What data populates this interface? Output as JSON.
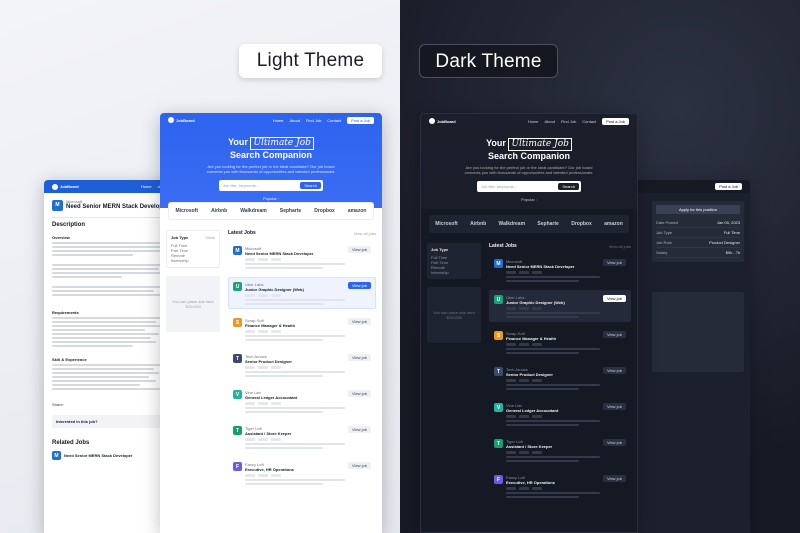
{
  "labels": {
    "light": "Light Theme",
    "dark": "Dark Theme"
  },
  "brand": {
    "name": "JobBoard"
  },
  "nav": [
    "Home",
    "About",
    "Find Job",
    "Contact"
  ],
  "signup": "Post a Job",
  "hero": {
    "line1_prefix": "Your",
    "highlight": "Ultimate Job",
    "line2": "Search Companion",
    "sub": "Are you looking for the perfect job or the ideal candidate? Our job board connects you with thousands of opportunities and talented professionals.",
    "search_placeholder": "Job title, keywords...",
    "search_button": "Search",
    "popular_label": "Popular :"
  },
  "brands": [
    "Microsoft",
    "Airbnb",
    "Walkdream",
    "Sepharte",
    "Dropbox",
    "amazon"
  ],
  "filters": {
    "title": "Job Type",
    "reset": "Clear",
    "items": [
      "Full Time",
      "Part Time",
      "Remote",
      "Internship"
    ],
    "ad": "You can place ads here 300×250"
  },
  "latest": {
    "title": "Latest Jobs",
    "view_all": "View all jobs"
  },
  "jobs": [
    {
      "company": "Microsoft",
      "title": "Need Senior MERN Stack Developer",
      "tags": [
        "Full Time",
        "Mid Level",
        "Remote"
      ],
      "apply": "View job",
      "color": "#1f6fd1",
      "letter": "M"
    },
    {
      "company": "Uber Labs",
      "title": "Junior Graphic Designer (Web)",
      "tags": [
        "Part Time",
        "Entry",
        "Onsite"
      ],
      "apply": "View job",
      "color": "#1aa37a",
      "letter": "U"
    },
    {
      "company": "Scrap Soft",
      "title": "Finance Manager & Health",
      "tags": [
        "Full Time",
        "Senior",
        "Remote"
      ],
      "apply": "View job",
      "color": "#e69b1b",
      "letter": "S"
    },
    {
      "company": "Tech Arrows",
      "title": "Senior Product Designer",
      "tags": [
        "Full Time",
        "Senior",
        "Onsite"
      ],
      "apply": "View job",
      "color": "#3b4a6b",
      "letter": "T"
    },
    {
      "company": "Vine Lab",
      "title": "General Ledger Accountant",
      "tags": [
        "Contract",
        "Mid Level",
        "Remote"
      ],
      "apply": "View job",
      "color": "#22b3a2",
      "letter": "V"
    },
    {
      "company": "Tiger Loft",
      "title": "Assistant / Store Keeper",
      "tags": [
        "Part Time",
        "Entry",
        "Onsite"
      ],
      "apply": "View job",
      "color": "#16a06b",
      "letter": "T"
    },
    {
      "company": "Fancy Loft",
      "title": "Executive, HR Operations",
      "tags": [
        "Full Time",
        "Mid Level",
        "Remote"
      ],
      "apply": "View job",
      "color": "#6a5ce0",
      "letter": "F"
    }
  ],
  "detail": {
    "company": "Microsoft",
    "title": "Need Senior MERN Stack Developer",
    "description": "Description",
    "overview": "Overview",
    "requirements": "Requirements",
    "skills": "Skill & Experience",
    "share": "Share:",
    "interested": "Interested in this job?",
    "related": "Related Jobs",
    "related_job": "Need Senior MERN Stack Developer",
    "apply": "Apply for this position"
  },
  "sidebar_info": [
    [
      "Date Posted",
      "Jan 05, 2023"
    ],
    [
      "Job Type",
      "Full Time"
    ],
    [
      "Job Role",
      "Product Designer"
    ],
    [
      "Salary",
      "$5k - 7k"
    ]
  ]
}
